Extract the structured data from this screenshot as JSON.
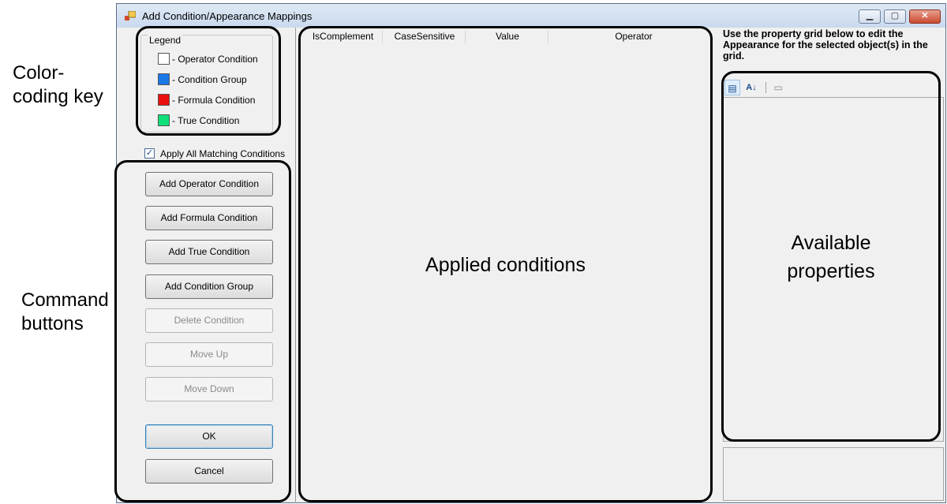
{
  "annotations": {
    "color_key_line1": "Color-",
    "color_key_line2": "coding key",
    "command_line1": "Command",
    "command_line2": "buttons",
    "applied_conditions": "Applied conditions",
    "available_line1": "Available",
    "available_line2": "properties"
  },
  "window": {
    "title": "Add Condition/Appearance Mappings",
    "minimize": "▁",
    "maximize": "▢",
    "close": "✕"
  },
  "legend": {
    "title": "Legend",
    "items": [
      {
        "label": "- Operator Condition",
        "color": "#ffffff"
      },
      {
        "label": "- Condition Group",
        "color": "#1a78e6"
      },
      {
        "label": "- Formula Condition",
        "color": "#ea1010"
      },
      {
        "label": "- True Condition",
        "color": "#10e07a"
      }
    ]
  },
  "apply_all": {
    "label": "Apply All Matching Conditions",
    "checked": true,
    "mark": "✓"
  },
  "buttons": {
    "add_operator": "Add Operator Condition",
    "add_formula": "Add Formula Condition",
    "add_true": "Add True Condition",
    "add_group": "Add Condition Group",
    "delete": "Delete Condition",
    "move_up": "Move Up",
    "move_down": "Move Down",
    "ok": "OK",
    "cancel": "Cancel"
  },
  "grid": {
    "columns": [
      "IsComplement",
      "CaseSensitive",
      "Value",
      "Operator"
    ]
  },
  "property_panel": {
    "instruction": "Use the property grid below to edit the Appearance for the selected object(s) in the grid.",
    "categorized_icon": "▤",
    "alphabetical_icon": "A↓",
    "pages_icon": "▭"
  }
}
